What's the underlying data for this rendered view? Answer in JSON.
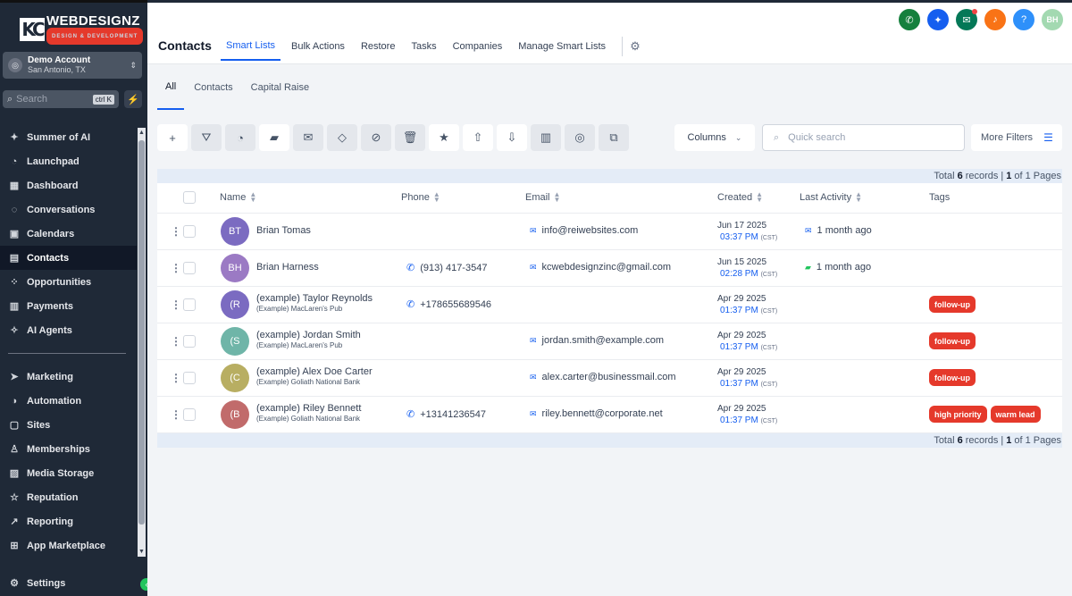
{
  "sidebar": {
    "logo": {
      "mark": "KC",
      "brand": "WEBDESIGNZ",
      "tagline": "DESIGN & DEVELOPMENT"
    },
    "account": {
      "name": "Demo Account",
      "location": "San Antonio, TX"
    },
    "search": {
      "placeholder": "Search",
      "shortcut": "ctrl K"
    },
    "items": [
      {
        "label": "Summer of AI",
        "icon": "sparkle-icon"
      },
      {
        "label": "Launchpad",
        "icon": "rocket-icon"
      },
      {
        "label": "Dashboard",
        "icon": "dashboard-icon"
      },
      {
        "label": "Conversations",
        "icon": "chat-icon"
      },
      {
        "label": "Calendars",
        "icon": "calendar-icon"
      },
      {
        "label": "Contacts",
        "icon": "contacts-icon"
      },
      {
        "label": "Opportunities",
        "icon": "opportunities-icon"
      },
      {
        "label": "Payments",
        "icon": "payments-icon"
      },
      {
        "label": "AI Agents",
        "icon": "ai-agents-icon"
      }
    ],
    "items2": [
      {
        "label": "Marketing",
        "icon": "marketing-icon"
      },
      {
        "label": "Automation",
        "icon": "automation-icon"
      },
      {
        "label": "Sites",
        "icon": "sites-icon"
      },
      {
        "label": "Memberships",
        "icon": "memberships-icon"
      },
      {
        "label": "Media Storage",
        "icon": "media-storage-icon"
      },
      {
        "label": "Reputation",
        "icon": "star-icon"
      },
      {
        "label": "Reporting",
        "icon": "reporting-icon"
      },
      {
        "label": "App Marketplace",
        "icon": "app-marketplace-icon"
      }
    ],
    "settings": "Settings"
  },
  "header": {
    "title": "Contacts",
    "tabs": [
      "Smart Lists",
      "Bulk Actions",
      "Restore",
      "Tasks",
      "Companies",
      "Manage Smart Lists"
    ],
    "user_initials": "BH",
    "colors": {
      "phone": "#15803d",
      "magic": "#155eef",
      "megaphone": "#047857",
      "bell": "#f97316",
      "help": "#2e90fa",
      "avatar": "#a3d9b1"
    }
  },
  "subtabs": [
    "All",
    "Contacts",
    "Capital Raise"
  ],
  "toolbar": {
    "buttons": [
      "add-icon",
      "filter-icon",
      "pipeline-icon",
      "sms-icon",
      "email-icon",
      "add-tag-icon",
      "remove-tag-icon",
      "delete-icon",
      "star-icon",
      "export-icon",
      "import-icon",
      "company-icon",
      "whatsapp-icon",
      "merge-icon"
    ],
    "columns_label": "Columns",
    "search_placeholder": "Quick search",
    "more_filters_label": "More Filters"
  },
  "table": {
    "totals": {
      "prefix": "Total",
      "count": "6",
      "records": "records |",
      "page": "1",
      "of": "of 1 Pages"
    },
    "headers": {
      "name": "Name",
      "phone": "Phone",
      "email": "Email",
      "created": "Created",
      "last_activity": "Last Activity",
      "tags": "Tags"
    },
    "rows": [
      {
        "initials": "BT",
        "color": "#7b6bc1",
        "name": "Brian Tomas",
        "company": "",
        "phone": "",
        "email": "info@reiwebsites.com",
        "date": "Jun 17 2025",
        "time": "03:37 PM",
        "tz": "(CST)",
        "activity": "1 month ago",
        "activity_icon": "email-icon",
        "tags": []
      },
      {
        "initials": "BH",
        "color": "#9b7ac4",
        "name": "Brian Harness",
        "company": "",
        "phone": "(913) 417-3547",
        "email": "kcwebdesignzinc@gmail.com",
        "date": "Jun 15 2025",
        "time": "02:28 PM",
        "tz": "(CST)",
        "activity": "1 month ago",
        "activity_icon": "sms-icon",
        "tags": []
      },
      {
        "initials": "(R",
        "color": "#7b6bc1",
        "name": "(example) Taylor Reynolds",
        "company": "(Example) MacLaren's Pub",
        "phone": "+178655689546",
        "email": "",
        "date": "Apr 29 2025",
        "time": "01:37 PM",
        "tz": "(CST)",
        "activity": "",
        "activity_icon": "",
        "tags": [
          "follow-up"
        ]
      },
      {
        "initials": "(S",
        "color": "#6fb5a8",
        "name": "(example) Jordan Smith",
        "company": "(Example) MacLaren's Pub",
        "phone": "",
        "email": "jordan.smith@example.com",
        "date": "Apr 29 2025",
        "time": "01:37 PM",
        "tz": "(CST)",
        "activity": "",
        "activity_icon": "",
        "tags": [
          "follow-up"
        ]
      },
      {
        "initials": "(C",
        "color": "#b8ae62",
        "name": "(example) Alex Doe Carter",
        "company": "(Example) Goliath National Bank",
        "phone": "",
        "email": "alex.carter@businessmail.com",
        "date": "Apr 29 2025",
        "time": "01:37 PM",
        "tz": "(CST)",
        "activity": "",
        "activity_icon": "",
        "tags": [
          "follow-up"
        ]
      },
      {
        "initials": "(B",
        "color": "#c16b6b",
        "name": "(example) Riley Bennett",
        "company": "(Example) Goliath National Bank",
        "phone": "+13141236547",
        "email": "riley.bennett@corporate.net",
        "date": "Apr 29 2025",
        "time": "01:37 PM",
        "tz": "(CST)",
        "activity": "",
        "activity_icon": "",
        "tags": [
          "high priority",
          "warm lead"
        ]
      }
    ]
  }
}
